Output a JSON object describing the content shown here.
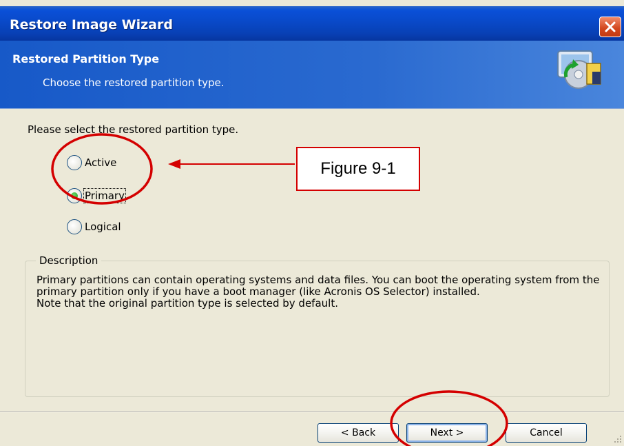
{
  "window": {
    "title": "Restore Image Wizard"
  },
  "header": {
    "title": "Restored Partition Type",
    "subtitle": "Choose the restored partition type."
  },
  "prompt": "Please select the restored partition type.",
  "options": [
    {
      "label": "Active",
      "selected": false
    },
    {
      "label": "Primary",
      "selected": true
    },
    {
      "label": "Logical",
      "selected": false
    }
  ],
  "description": {
    "legend": "Description",
    "lines": [
      "Primary partitions can contain operating systems and data files. You can boot the operating system from the primary partition only if you have a boot manager (like Acronis OS Selector) installed.",
      "Note that the original partition type is selected by default."
    ]
  },
  "buttons": {
    "back": "< Back",
    "next": "Next >",
    "cancel": "Cancel"
  },
  "annotation": {
    "label": "Figure 9-1",
    "color": "#d40000"
  },
  "icons": [
    "close-icon",
    "wizard-computer-icon",
    "size-grip-icon"
  ]
}
